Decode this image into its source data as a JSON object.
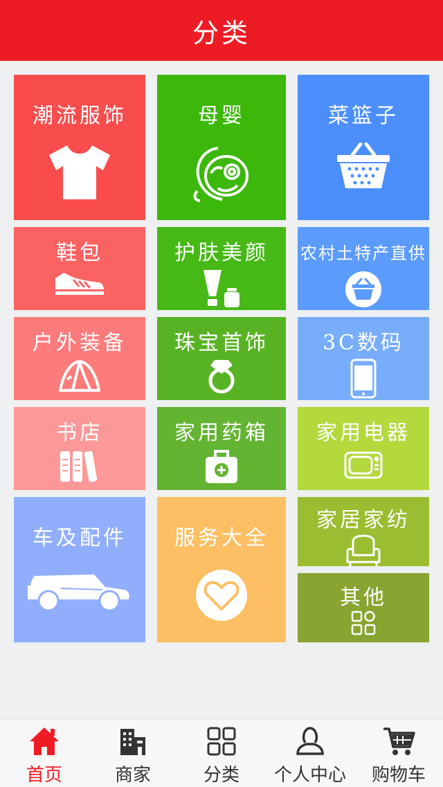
{
  "header": {
    "title": "分类"
  },
  "tiles": [
    {
      "label": "潮流服饰",
      "icon": "tshirt-icon",
      "color": "#f94d4d"
    },
    {
      "label": "母婴",
      "icon": "baby-icon",
      "color": "#3cb80b"
    },
    {
      "label": "菜篮子",
      "icon": "basket-icon",
      "color": "#4c8ffc"
    },
    {
      "label": "鞋包",
      "icon": "sneaker-icon",
      "color": "#fb6262"
    },
    {
      "label": "护肤美颜",
      "icon": "cosmetics-icon",
      "color": "#46b916"
    },
    {
      "label": "农村土特产直供",
      "icon": "farm-basket-icon",
      "color": "#5b9bfc"
    },
    {
      "label": "户外装备",
      "icon": "tent-icon",
      "color": "#fd7b7b"
    },
    {
      "label": "珠宝首饰",
      "icon": "ring-icon",
      "color": "#57b324"
    },
    {
      "label": "3C数码",
      "icon": "phone-icon",
      "color": "#77adfb"
    },
    {
      "label": "书店",
      "icon": "books-icon",
      "color": "#fd9898"
    },
    {
      "label": "家用药箱",
      "icon": "medicine-box-icon",
      "color": "#63b432"
    },
    {
      "label": "家用电器",
      "icon": "tv-icon",
      "color": "#b3d93d"
    },
    {
      "label": "车及配件",
      "icon": "car-icon",
      "color": "#90aefb"
    },
    {
      "label": "服务大全",
      "icon": "heart-icon",
      "color": "#fdbf63"
    },
    {
      "label": "家居家纺",
      "icon": "armchair-icon",
      "color": "#9bbd31"
    },
    {
      "label": "其他",
      "icon": "grid-icon",
      "color": "#88a531"
    }
  ],
  "tabbar": {
    "items": [
      {
        "label": "首页",
        "icon": "home-icon",
        "active": true
      },
      {
        "label": "商家",
        "icon": "building-icon",
        "active": false
      },
      {
        "label": "分类",
        "icon": "category-icon",
        "active": false
      },
      {
        "label": "个人中心",
        "icon": "user-icon",
        "active": false
      },
      {
        "label": "购物车",
        "icon": "cart-icon",
        "active": false
      }
    ],
    "active_color": "#ed1c24"
  }
}
